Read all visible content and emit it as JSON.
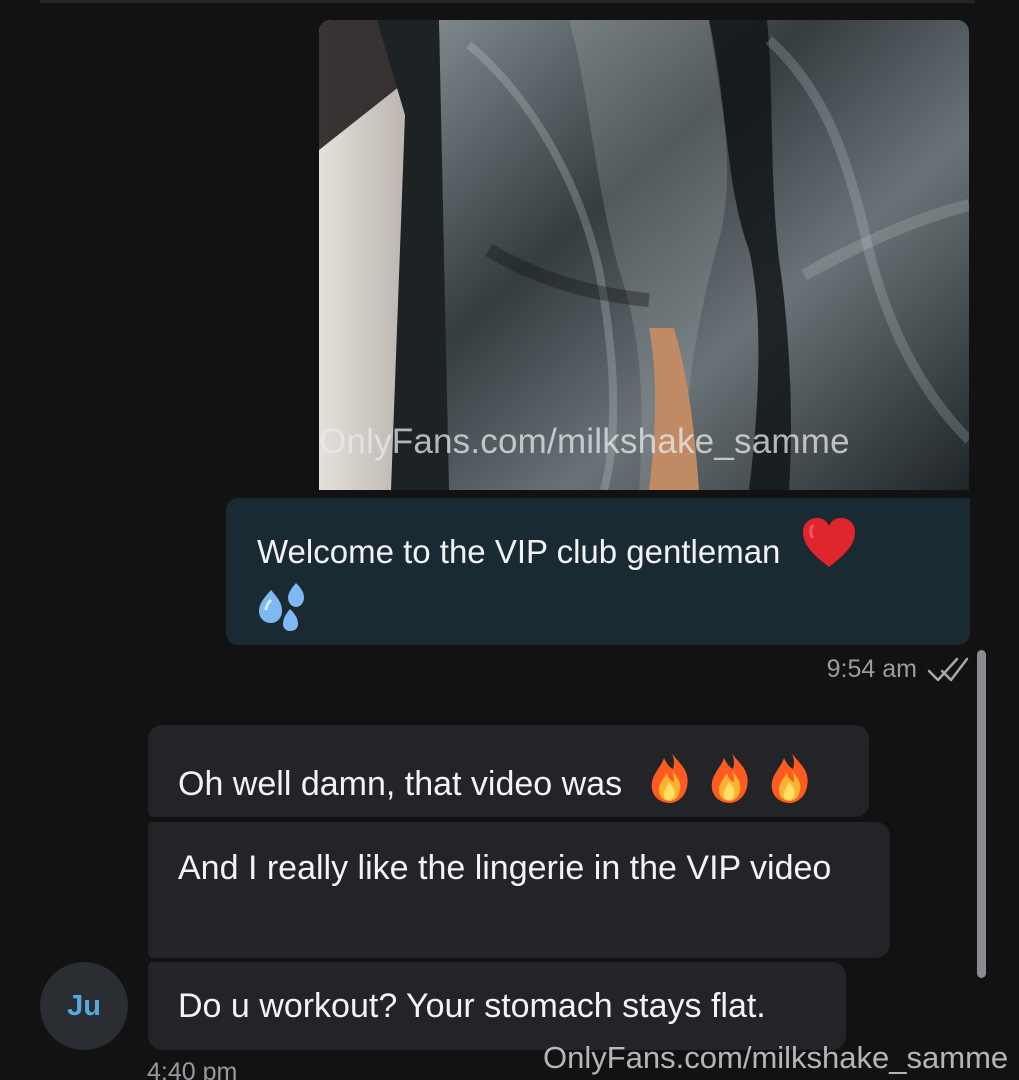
{
  "conversation": {
    "media": {
      "watermark": "OnlyFans.com/milkshake_samme"
    },
    "outgoing": {
      "message_text": "Welcome to the VIP club gentleman",
      "time": "9:54 am",
      "status_icon": "double-check-icon"
    },
    "incoming": {
      "avatar_initials": "Ju",
      "messages": [
        {
          "text": "Oh well damn, that video was"
        },
        {
          "text": "And I really like the lingerie in the VIP video"
        },
        {
          "text": "Do u workout? Your stomach stays flat."
        }
      ],
      "time": "4:40 pm"
    },
    "footer_watermark": "OnlyFans.com/milkshake_samme"
  },
  "colors": {
    "background": "#121213",
    "outgoing_bubble": "#1a2a32",
    "incoming_bubble": "#232428",
    "avatar_text": "#55a9df"
  },
  "icons": {
    "heart": "heart-icon",
    "drops": "sweat-droplets-icon",
    "fire": "fire-icon"
  }
}
